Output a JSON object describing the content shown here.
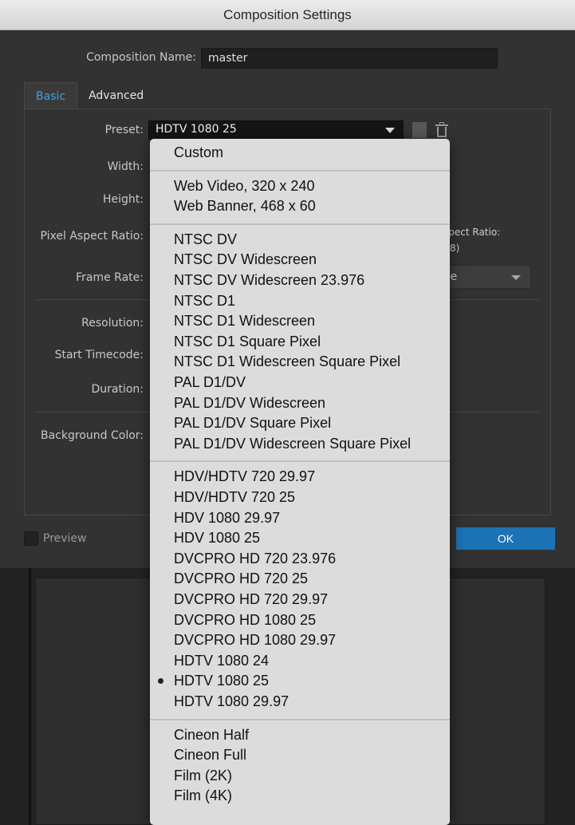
{
  "window": {
    "title": "Composition Settings"
  },
  "composition_name": {
    "label": "Composition Name:",
    "value": "master"
  },
  "tabs": [
    "Basic",
    "Advanced"
  ],
  "fields": {
    "preset_label": "Preset:",
    "preset_value": "HDTV 1080 25",
    "width_label": "Width:",
    "height_label": "Height:",
    "pixel_aspect_label": "Pixel Aspect Ratio:",
    "frame_rate_label": "Frame Rate:",
    "resolution_label": "Resolution:",
    "start_timecode_label": "Start Timecode:",
    "duration_label": "Duration:",
    "background_color_label": "Background Color:"
  },
  "partial": {
    "aspect_ratio_fragment": "spect Ratio:",
    "aspect_ratio_value_fragment": "8)",
    "frame_select_fragment": "me"
  },
  "footer": {
    "preview_label": "Preview",
    "ok_label": "OK"
  },
  "preset_menu": {
    "selected": "HDTV 1080 25",
    "groups": [
      [
        "Custom"
      ],
      [
        "Web Video, 320 x 240",
        "Web Banner, 468 x 60"
      ],
      [
        "NTSC DV",
        "NTSC DV Widescreen",
        "NTSC DV Widescreen 23.976",
        "NTSC D1",
        "NTSC D1 Widescreen",
        "NTSC D1 Square Pixel",
        "NTSC D1 Widescreen Square Pixel",
        "PAL D1/DV",
        "PAL D1/DV Widescreen",
        "PAL D1/DV Square Pixel",
        "PAL D1/DV Widescreen Square Pixel"
      ],
      [
        "HDV/HDTV 720 29.97",
        "HDV/HDTV 720 25",
        "HDV 1080 29.97",
        "HDV 1080 25",
        "DVCPRO HD 720 23.976",
        "DVCPRO HD 720 25",
        "DVCPRO HD 720 29.97",
        "DVCPRO HD 1080 25",
        "DVCPRO HD 1080 29.97",
        "HDTV 1080 24",
        "HDTV 1080 25",
        "HDTV 1080 29.97"
      ],
      [
        "Cineon Half",
        "Cineon Full",
        "Film (2K)",
        "Film (4K)"
      ]
    ]
  },
  "icons": {
    "save": "save-preset-icon",
    "delete": "trash-icon"
  },
  "colors": {
    "accent": "#3ea1e8",
    "ok_button": "#1b72b4",
    "menu_bg": "#dcdcdc"
  }
}
